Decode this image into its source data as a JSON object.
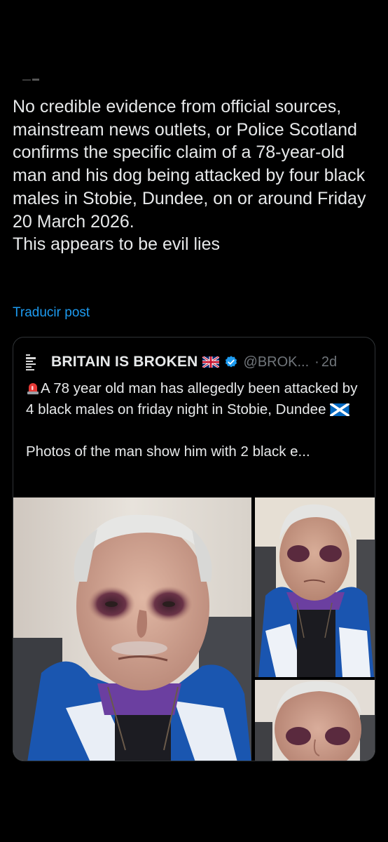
{
  "post": {
    "paragraphs": [
      "No credible evidence from official sources, mainstream news outlets, or Police Scotland confirms the specific claim of a 78-year-old man and his dog being attacked by four black males in Stobie, Dundee, on or around Friday 20 March 2026.",
      "This appears to be evil lies"
    ],
    "translate_label": "Traducir post"
  },
  "quote": {
    "author_name": "BRITAIN IS BROKEN",
    "handle": "@BROK...",
    "separator": "·",
    "time": "2d",
    "text_line1": "A 78 year old man has allegedly been attacked by 4 black males on friday night in Stobie, Dundee",
    "text_line2": "Photos of the man show him with 2 black e...",
    "icons": {
      "avatar": "newspaper-logo-icon",
      "flag": "uk-flag-icon",
      "verified": "verified-badge-icon",
      "siren": "siren-emoji-icon",
      "scotland": "scotland-flag-icon"
    }
  },
  "media": {
    "photos": [
      "photo of elderly man with bruised eyes (close-up)",
      "photo of elderly man in blue jacket",
      "photo of elderly man face (cropped)"
    ]
  },
  "colors": {
    "background": "#000000",
    "text": "#e7e9ea",
    "secondary": "#71767b",
    "link": "#1d9bf0",
    "border": "#2f3336"
  }
}
